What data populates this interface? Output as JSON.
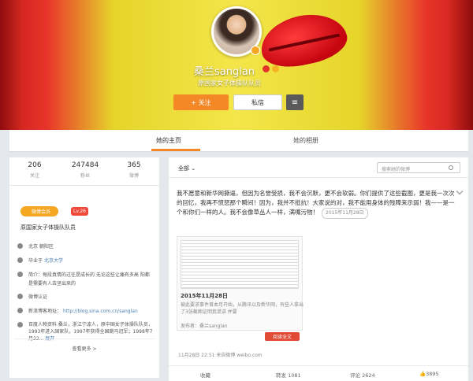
{
  "profile": {
    "name": "桑兰sanglan",
    "description": "原国家女子体操队队员",
    "follow_label": "+ 关注",
    "message_label": "私信",
    "more_label": "≡"
  },
  "tabs": [
    "她的主页",
    "她的相册"
  ],
  "stats": [
    {
      "value": "206",
      "label": "关注"
    },
    {
      "value": "247484",
      "label": "粉丝"
    },
    {
      "value": "365",
      "label": "微博"
    }
  ],
  "left": {
    "vip_label": "微博会员",
    "level_label": "Lv.26",
    "desc": "原国家女子体操队队员",
    "location": "北京 朝阳区",
    "school_prefix": "毕业于",
    "school": "北京大学",
    "intro": "简介：每段真情的过往是成长的 无论这些让痛有多高 阳都是需要有人去坚出来的",
    "verified": "微博认证",
    "blog_prefix": "新浪博客地址：",
    "blog_url": "http://blog.sina.com.cn/sanglan",
    "bio": "百度人物资料 桑兰，浙江宁波人，原中国女子体操队队员，1993年进入国家队，1997年获得全国跳马冠军；1998年7月22...",
    "bio_link": "展开",
    "see_more": "查看更多 >"
  },
  "feed": {
    "filter": "全部",
    "search_placeholder": "搜索她的微博",
    "post_text": "我不愿意和新华网撕逼，但因为名誉受损，我不会沉默，更不会软弱。你们提供了这些截图，更是我一次次的回忆，我再不愤怒那个瞬间！因为，我并不抵抗！大家说的对，我不能用身体的残障来示弱！我——是一个和你们一样的人。我不会像草丛人一样，满嘴污物！",
    "tag": "2015年11月28日",
    "card_title": "2015年11月28日",
    "card_desc": "被此要求事件首本月开始，从腾讯以及新华网，有些人拿出了3张截图证明我谎讲 并要",
    "card_author": "发布者：桑兰sanglan",
    "read_label": "阅读全文",
    "meta": "11月28日 22:51 来自微博 weibo.com",
    "actions": [
      "收藏",
      "转发 1081",
      "评论 2624",
      "3895"
    ]
  }
}
